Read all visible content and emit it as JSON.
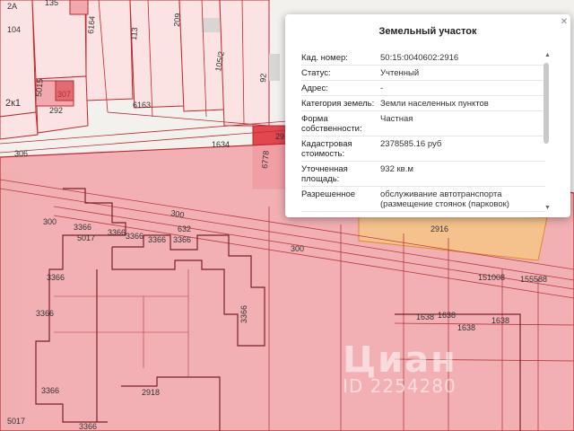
{
  "map": {
    "labels": [
      {
        "id": "l-104",
        "text": "104"
      },
      {
        "id": "l-2a",
        "text": "2А"
      },
      {
        "id": "l-135",
        "text": "135"
      },
      {
        "id": "l-6164",
        "text": "6164"
      },
      {
        "id": "l-113",
        "text": "113"
      },
      {
        "id": "l-209",
        "text": "209"
      },
      {
        "id": "l-105-2",
        "text": "105/2"
      },
      {
        "id": "l-92",
        "text": "92"
      },
      {
        "id": "l-2k1",
        "text": "2к1"
      },
      {
        "id": "l-5015",
        "text": "5015"
      },
      {
        "id": "l-307",
        "text": "307"
      },
      {
        "id": "l-292",
        "text": "292"
      },
      {
        "id": "l-6163",
        "text": "6163"
      },
      {
        "id": "l-1634",
        "text": "1634"
      },
      {
        "id": "l-29",
        "text": "29"
      },
      {
        "id": "l-6778",
        "text": "6778"
      },
      {
        "id": "l-306",
        "text": "306"
      },
      {
        "id": "l-300a",
        "text": "300"
      },
      {
        "id": "l-300b",
        "text": "300"
      },
      {
        "id": "l-300c",
        "text": "300"
      },
      {
        "id": "l-5017a",
        "text": "5017"
      },
      {
        "id": "l-3366a",
        "text": "3366"
      },
      {
        "id": "l-3366b",
        "text": "3366"
      },
      {
        "id": "l-3366c",
        "text": "3366"
      },
      {
        "id": "l-3366d",
        "text": "3366"
      },
      {
        "id": "l-3366e",
        "text": "3366"
      },
      {
        "id": "l-3366f",
        "text": "3366"
      },
      {
        "id": "l-3366g",
        "text": "3366"
      },
      {
        "id": "l-3366h",
        "text": "3366"
      },
      {
        "id": "l-3366i",
        "text": "3366"
      },
      {
        "id": "l-632",
        "text": "632"
      },
      {
        "id": "l-2916",
        "text": "2916"
      },
      {
        "id": "l-151008",
        "text": "151008"
      },
      {
        "id": "l-155588",
        "text": "155588"
      },
      {
        "id": "l-1638a",
        "text": "1638"
      },
      {
        "id": "l-1638b",
        "text": "1638"
      },
      {
        "id": "l-1638c",
        "text": "1638"
      },
      {
        "id": "l-1638d",
        "text": "1638"
      },
      {
        "id": "l-2918",
        "text": "2918"
      },
      {
        "id": "l-5017b",
        "text": "5017"
      },
      {
        "id": "l-3366j",
        "text": "3366"
      }
    ],
    "colors": {
      "background": "#f3f1ee",
      "parcel_fill": "#f2a9ad",
      "parcel_stroke": "#c0282f",
      "highlight_fill": "#f5c48a",
      "green_strip": "#d9ecc9"
    }
  },
  "watermark": {
    "brand": "Циан",
    "id_text": "ID 2254280"
  },
  "popup": {
    "title": "Земельный участок",
    "rows": [
      {
        "key": "Кад. номер:",
        "value": "50:15:0040602:2916"
      },
      {
        "key": "Статус:",
        "value": "Учтенный"
      },
      {
        "key": "Адрес:",
        "value": "-"
      },
      {
        "key": "Категория земель:",
        "value": "Земли населенных пунктов"
      },
      {
        "key": "Форма собственности:",
        "value": "Частная"
      },
      {
        "key": "Кадастровая стоимость:",
        "value": "2378585.16 руб"
      },
      {
        "key": "Уточненная площадь:",
        "value": "932 кв.м"
      },
      {
        "key": "Разрешенное",
        "value": "обслуживание автотранспорта (размещение стоянок (парковок)"
      }
    ],
    "close_icon": "close-icon",
    "scroll_up_icon": "triangle-up-icon",
    "scroll_down_icon": "triangle-down-icon"
  }
}
